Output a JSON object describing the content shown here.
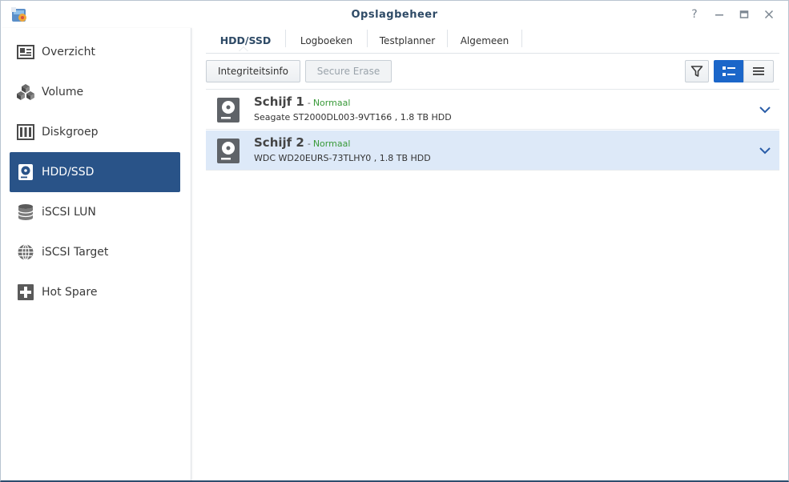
{
  "window": {
    "title": "Opslagbeheer",
    "controls": {
      "help": "?",
      "minimize": "—",
      "maximize": "□",
      "close": "✕"
    }
  },
  "sidebar": {
    "items": [
      {
        "label": "Overzicht",
        "icon": "overview-icon"
      },
      {
        "label": "Volume",
        "icon": "volume-cubes-icon"
      },
      {
        "label": "Diskgroep",
        "icon": "diskgroup-icon"
      },
      {
        "label": "HDD/SSD",
        "icon": "hdd-icon",
        "active": true
      },
      {
        "label": "iSCSI LUN",
        "icon": "database-icon"
      },
      {
        "label": "iSCSI Target",
        "icon": "globe-icon"
      },
      {
        "label": "Hot Spare",
        "icon": "hot-spare-plus-icon"
      }
    ]
  },
  "tabs": [
    {
      "label": "HDD/SSD",
      "active": true
    },
    {
      "label": "Logboeken"
    },
    {
      "label": "Testplanner"
    },
    {
      "label": "Algemeen"
    }
  ],
  "toolbar": {
    "integrity_label": "Integriteitsinfo",
    "secure_erase_label": "Secure Erase"
  },
  "disks": [
    {
      "name": "Schijf 1",
      "status": "Normaal",
      "description": "Seagate ST2000DL003-9VT166 , 1.8 TB HDD",
      "selected": false
    },
    {
      "name": "Schijf 2",
      "status": "Normaal",
      "description": "WDC WD20EURS-73TLHY0 , 1.8 TB HDD",
      "selected": true
    }
  ],
  "colors": {
    "accent": "#295388",
    "status_ok": "#3a9a3a",
    "selected_row": "#dde9f8",
    "title_text": "#2e4a66"
  }
}
